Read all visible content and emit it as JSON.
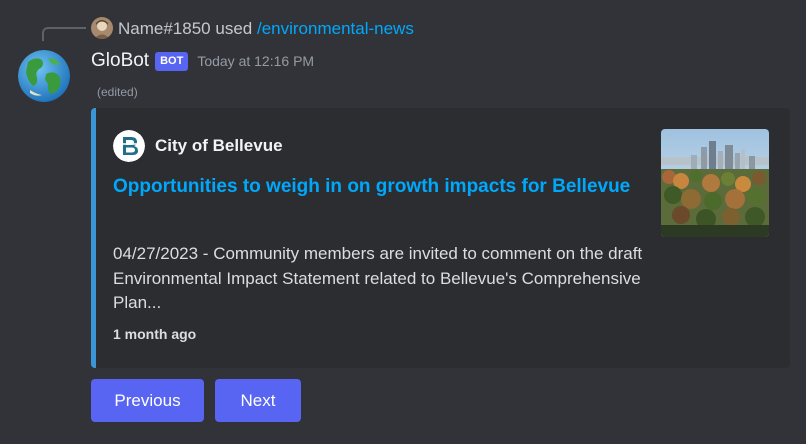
{
  "reply": {
    "user": "Name#1850",
    "used_text": "used",
    "command": "/environmental-news"
  },
  "message": {
    "author": "GloBot",
    "badge": "BOT",
    "timestamp": "Today at 12:16 PM",
    "edited": "(edited)",
    "avatar_icon": "earth-globe-icon"
  },
  "embed": {
    "accent_color": "#3b96d8",
    "author_name": "City of Bellevue",
    "author_icon": "city-of-bellevue-logo",
    "title": "Opportunities to weigh in on growth impacts for Bellevue",
    "description": "04/27/2023 - Community members are invited to comment on the draft Environmental Impact Statement related to Bellevue's Comprehensive Plan...",
    "footer": "1 month ago",
    "thumbnail": "bellevue-skyline-thumbnail"
  },
  "buttons": {
    "previous": "Previous",
    "next": "Next"
  },
  "colors": {
    "background": "#323339",
    "embed_background": "#2b2d31",
    "link": "#00a8fc",
    "button": "#5865f2"
  }
}
